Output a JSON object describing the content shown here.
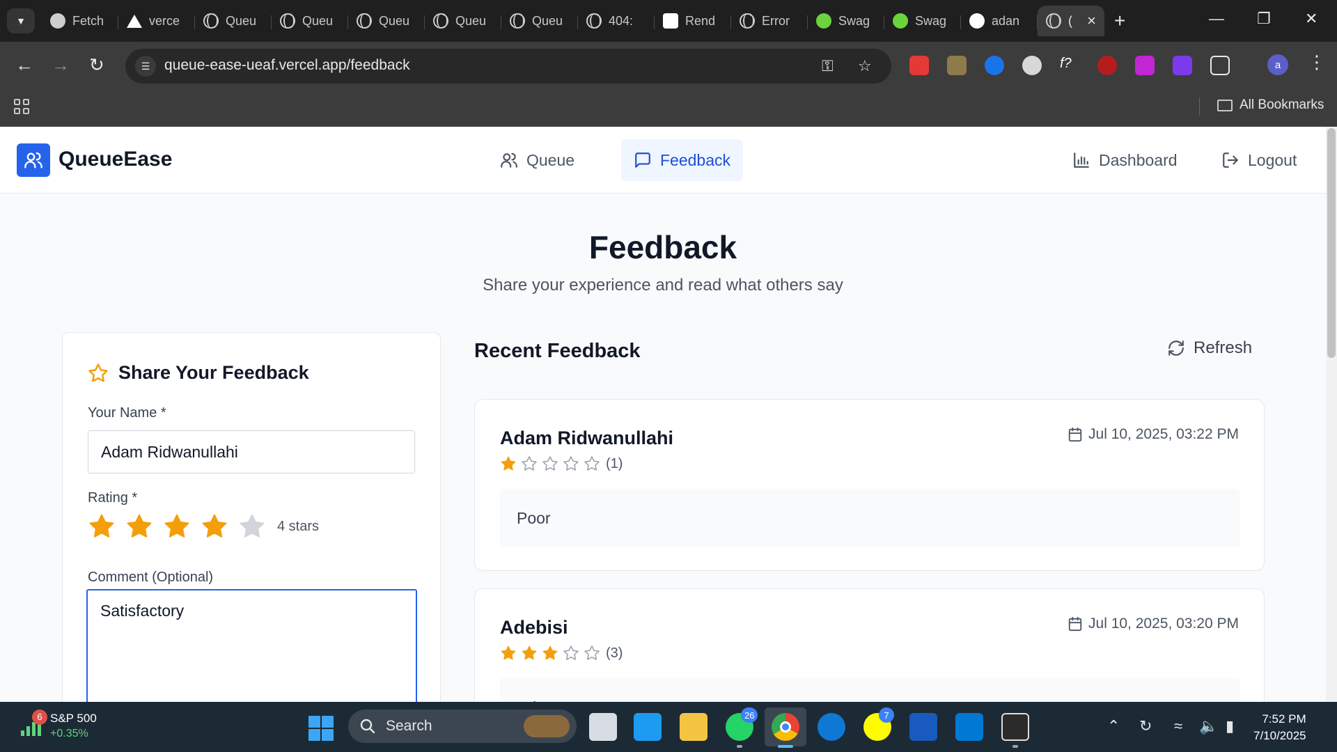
{
  "browser": {
    "tabs": [
      {
        "label": "Fetch",
        "favicon": "openai-icon"
      },
      {
        "label": "verce",
        "favicon": "vercel-icon"
      },
      {
        "label": "Queu",
        "favicon": "globe-icon"
      },
      {
        "label": "Queu",
        "favicon": "globe-icon"
      },
      {
        "label": "Queu",
        "favicon": "globe-icon"
      },
      {
        "label": "Queu",
        "favicon": "globe-icon"
      },
      {
        "label": "Queu",
        "favicon": "globe-icon"
      },
      {
        "label": "404:",
        "favicon": "globe-icon"
      },
      {
        "label": "Rend",
        "favicon": "render-icon"
      },
      {
        "label": "Error",
        "favicon": "globe-icon"
      },
      {
        "label": "Swag",
        "favicon": "swagger-icon"
      },
      {
        "label": "Swag",
        "favicon": "swagger-icon"
      },
      {
        "label": "adan",
        "favicon": "github-icon"
      },
      {
        "label": "(",
        "favicon": "globe-icon"
      }
    ],
    "url": "queue-ease-ueaf.vercel.app/feedback",
    "bookmarks_label": "All Bookmarks",
    "profile_initial": "a"
  },
  "app": {
    "brand": "QueueEase",
    "accent": "#2563eb",
    "nav": {
      "queue": "Queue",
      "feedback": "Feedback",
      "dashboard": "Dashboard",
      "logout": "Logout"
    }
  },
  "page": {
    "title": "Feedback",
    "subtitle": "Share your experience and read what others say"
  },
  "form": {
    "heading": "Share Your Feedback",
    "name_label": "Your Name *",
    "name_value": "Adam Ridwanullahi",
    "rating_label": "Rating *",
    "rating_value": 4,
    "rating_max": 5,
    "rating_text": "4 stars",
    "comment_label": "Comment (Optional)",
    "comment_value": "Satisfactory",
    "star_color": "#f59e0b"
  },
  "recent": {
    "heading": "Recent Feedback",
    "refresh_label": "Refresh",
    "items": [
      {
        "name": "Adam Ridwanullahi",
        "rating": 1,
        "rating_text": "(1)",
        "date": "Jul 10, 2025, 03:22 PM",
        "comment": "Poor"
      },
      {
        "name": "Adebisi",
        "rating": 3,
        "rating_text": "(3)",
        "date": "Jul 10, 2025, 03:20 PM",
        "comment": "Adequate"
      }
    ]
  },
  "taskbar": {
    "stock_name": "S&P 500",
    "stock_change": "+0.35%",
    "stock_badge": "6",
    "search_label": "Search",
    "whatsapp_badge": "26",
    "snapchat_badge": "7",
    "time": "7:52 PM",
    "date": "7/10/2025"
  }
}
